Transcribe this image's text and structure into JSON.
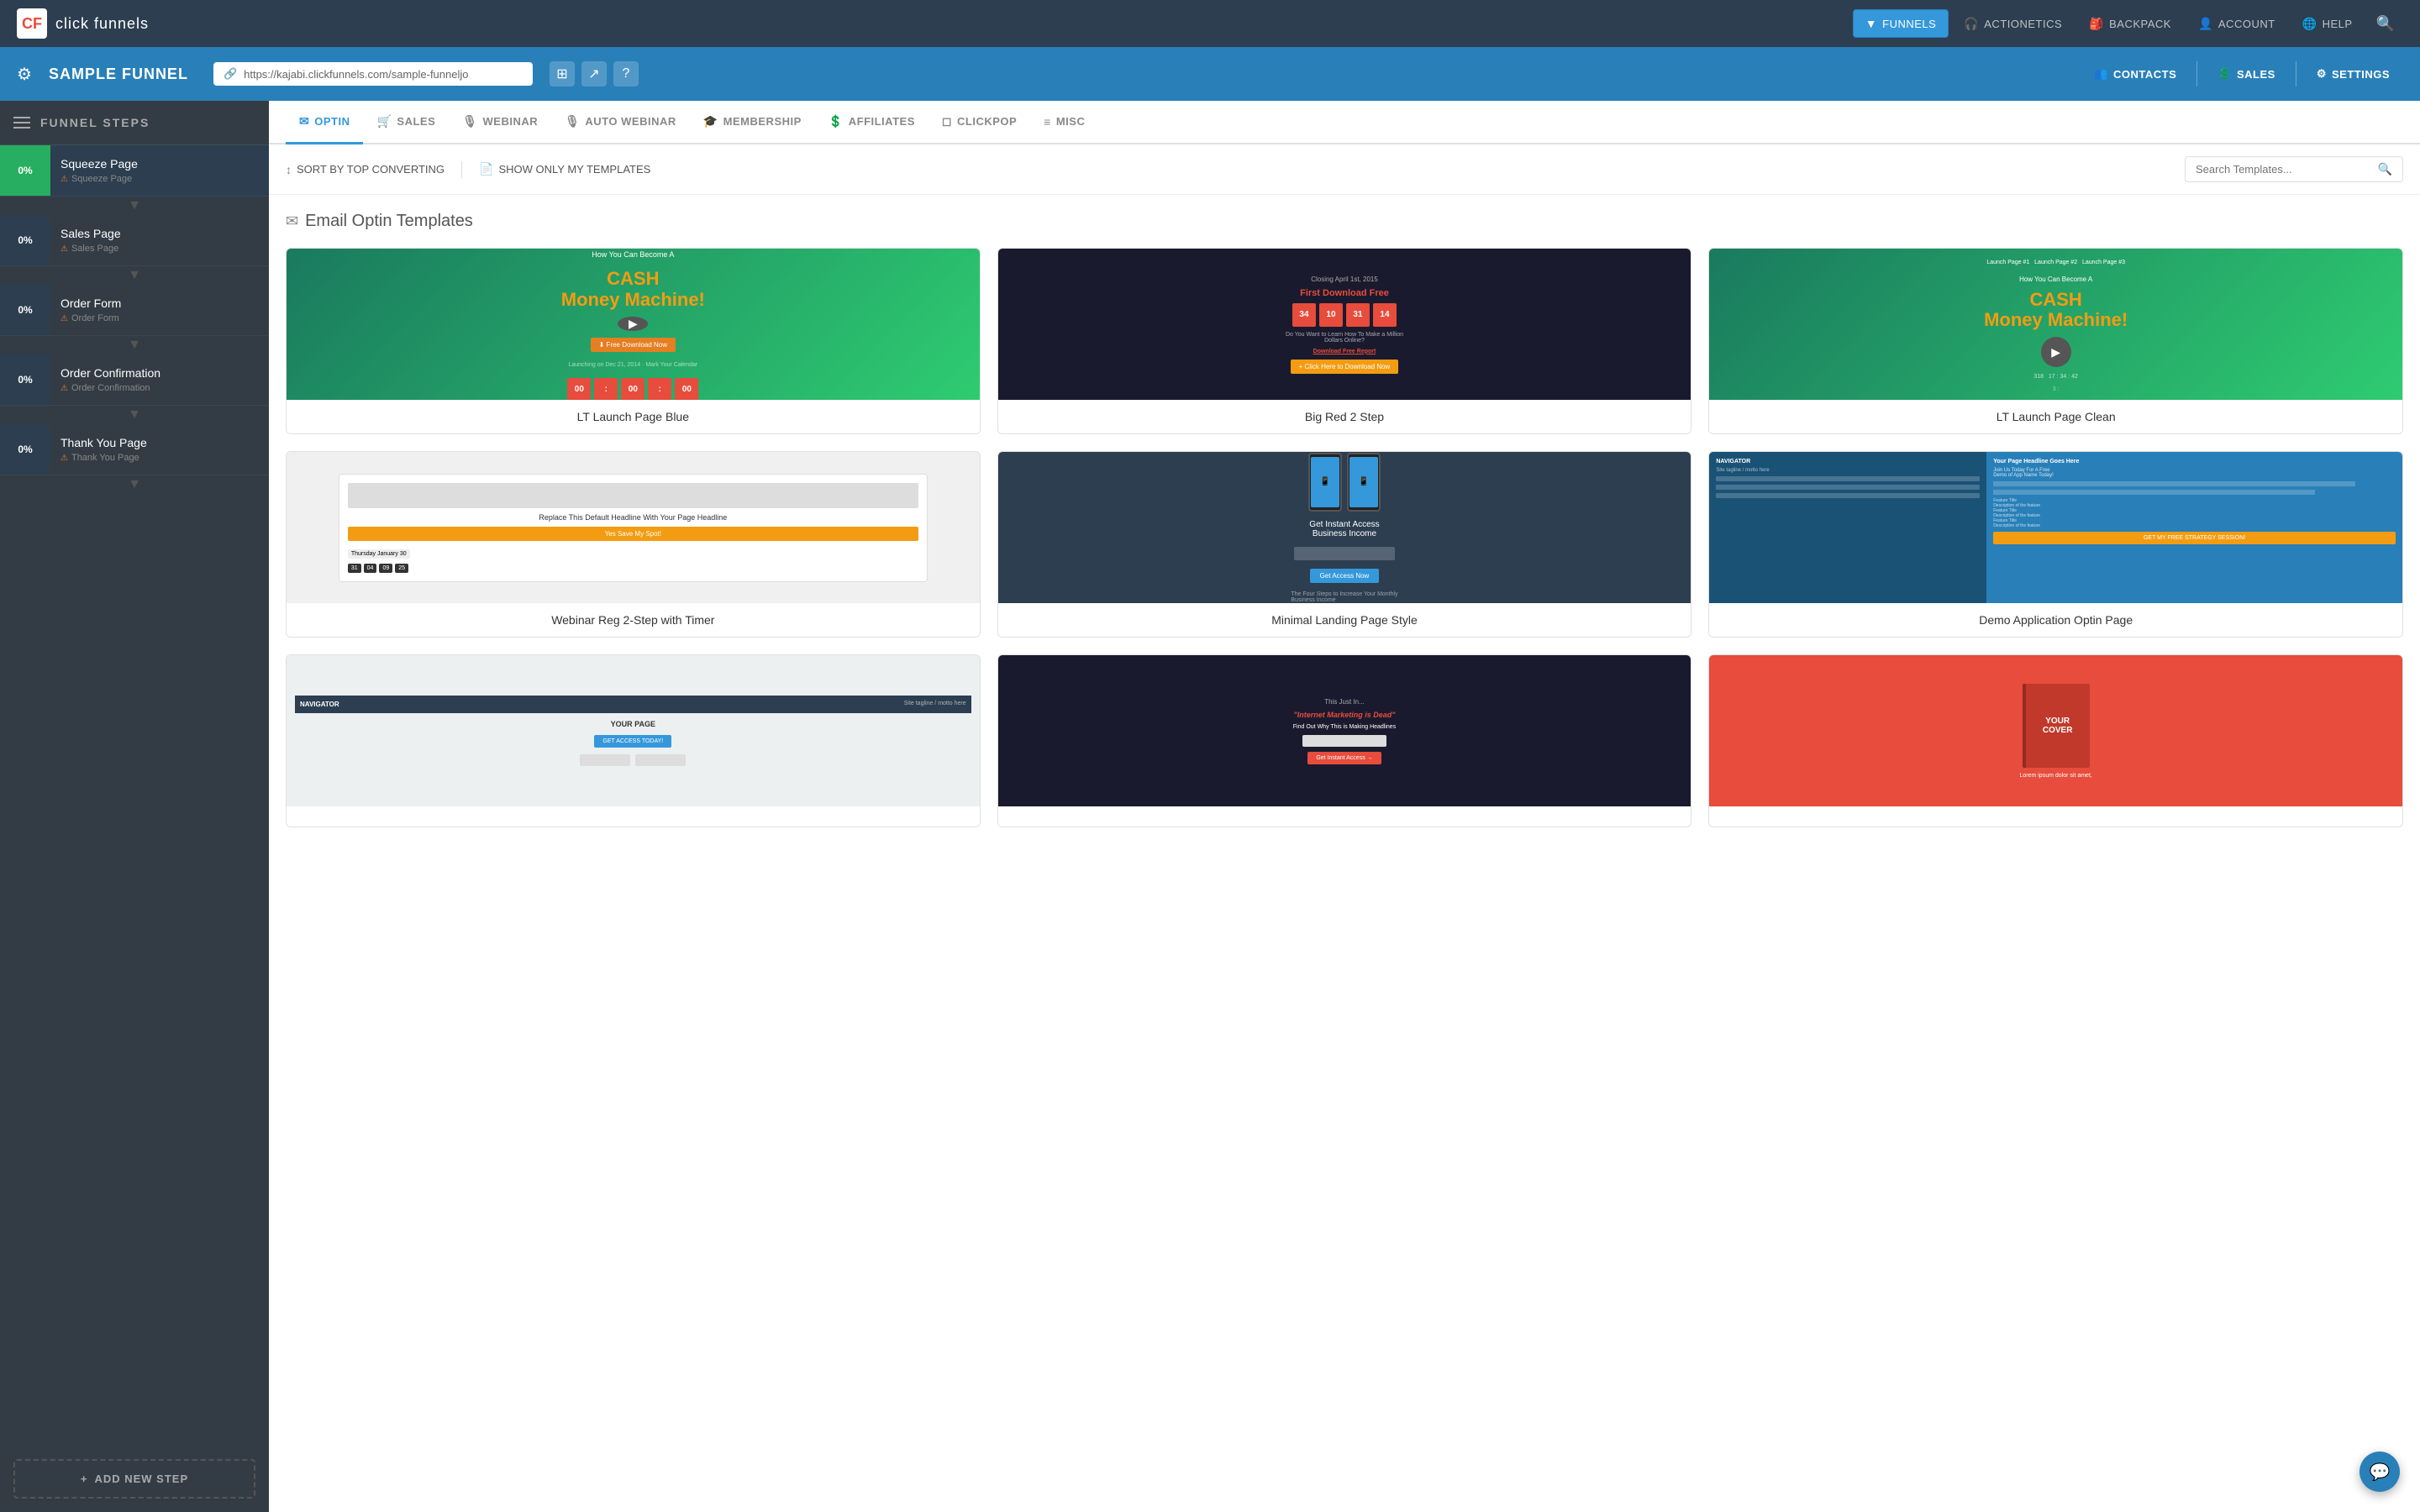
{
  "topNav": {
    "logo_text": "click funnels",
    "logo_icon": "CF",
    "nav_items": [
      {
        "id": "funnels",
        "label": "FUNNELS",
        "icon": "▼",
        "active": true
      },
      {
        "id": "actionetics",
        "label": "ACTIONETICS",
        "icon": "🎧"
      },
      {
        "id": "backpack",
        "label": "BACKPACK",
        "icon": "🎒"
      },
      {
        "id": "account",
        "label": "ACCOUNT",
        "icon": "👤"
      },
      {
        "id": "help",
        "label": "HELP",
        "icon": "🌐"
      }
    ],
    "search_icon": "🔍"
  },
  "funnelHeader": {
    "title": "SAMPLE FUNNEL",
    "url": "https://kajabi.clickfunnels.com/sample-funneljo",
    "contacts_label": "CONTACTS",
    "sales_label": "SALES",
    "settings_label": "SETTINGS",
    "copy_icon": "⊞",
    "open_icon": "↗",
    "help_icon": "?"
  },
  "sidebar": {
    "header_title": "FUNNEL STEPS",
    "steps": [
      {
        "id": "squeeze",
        "name": "Squeeze Page",
        "sub": "Squeeze Page",
        "percent": "0%",
        "active": true
      },
      {
        "id": "sales",
        "name": "Sales Page",
        "sub": "Sales Page",
        "percent": "0%",
        "active": false
      },
      {
        "id": "order-form",
        "name": "Order Form",
        "sub": "Order Form",
        "percent": "0%",
        "active": false
      },
      {
        "id": "order-confirm",
        "name": "Order Confirmation",
        "sub": "Order Confirmation",
        "percent": "0%",
        "active": false
      },
      {
        "id": "thank-you",
        "name": "Thank You Page",
        "sub": "Thank You Page",
        "percent": "0%",
        "active": false
      }
    ],
    "add_step_label": "ADD NEW STEP"
  },
  "tabs": [
    {
      "id": "optin",
      "label": "OPTIN",
      "icon": "✉",
      "active": true
    },
    {
      "id": "sales",
      "label": "SALES",
      "icon": "🛒",
      "active": false
    },
    {
      "id": "webinar",
      "label": "WEBINAR",
      "icon": "🎙",
      "active": false
    },
    {
      "id": "auto-webinar",
      "label": "AUTO WEBINAR",
      "icon": "🎙",
      "active": false
    },
    {
      "id": "membership",
      "label": "MEMBERSHIP",
      "icon": "🎓",
      "active": false
    },
    {
      "id": "affiliates",
      "label": "AFFILIATES",
      "icon": "💲",
      "active": false
    },
    {
      "id": "clickpop",
      "label": "CLICKPOP",
      "icon": "◻",
      "active": false
    },
    {
      "id": "misc",
      "label": "MISC",
      "icon": "≡",
      "active": false
    }
  ],
  "toolbar": {
    "sort_label": "SORT BY TOP CONVERTING",
    "show_my_label": "SHOW ONLY MY TEMPLATES",
    "search_placeholder": "Search Templates..."
  },
  "templates": {
    "section_title": "Email Optin Templates",
    "section_icon": "✉",
    "cards": [
      {
        "id": "lt-launch-blue",
        "name": "LT Launch Page Blue",
        "preview_type": "lt-launch-blue"
      },
      {
        "id": "big-red-2step",
        "name": "Big Red 2 Step",
        "preview_type": "big-red"
      },
      {
        "id": "lt-launch-clean",
        "name": "LT Launch Page Clean",
        "preview_type": "lt-clean"
      },
      {
        "id": "webinar-reg-2step",
        "name": "Webinar Reg 2-Step with Timer",
        "preview_type": "webinar"
      },
      {
        "id": "minimal-landing",
        "name": "Minimal Landing Page Style",
        "preview_type": "minimal"
      },
      {
        "id": "demo-application",
        "name": "Demo Application Optin Page",
        "preview_type": "demo"
      }
    ],
    "more_cards": [
      {
        "id": "navigator",
        "name": "",
        "preview_type": "navigator"
      },
      {
        "id": "internet-dead",
        "name": "",
        "preview_type": "internet-dead"
      },
      {
        "id": "cover",
        "name": "",
        "preview_type": "cover"
      }
    ]
  },
  "chat": {
    "icon": "💬"
  },
  "colors": {
    "active_tab": "#3498db",
    "sidebar_active": "#27ae60",
    "funnel_header": "#2980b9",
    "nav_bg": "#2c3e50"
  }
}
